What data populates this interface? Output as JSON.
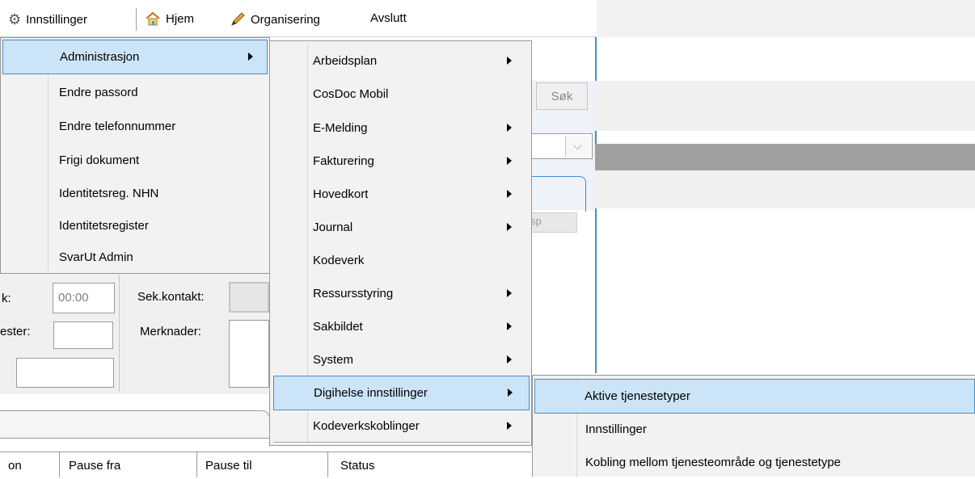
{
  "menubar": {
    "settings_label": "Innstillinger",
    "home_label": "Hjem",
    "organize_label": "Organisering",
    "exit_label": "Avslutt"
  },
  "background": {
    "search_label": "Søk",
    "time_value": "00:00",
    "partial_k_label": "k:",
    "sek_kontakt_label": "Sek.kontakt:",
    "partial_ester_label": "ester:",
    "merknader_label": "Merknader:",
    "partial_sp_label": "sp",
    "table_headers": [
      "on",
      "Pause fra",
      "Pause til",
      "Status"
    ]
  },
  "menu1": {
    "items": [
      {
        "label": "Administrasjon",
        "has_submenu": true
      },
      {
        "label": "Endre passord"
      },
      {
        "label": "Endre telefonnummer"
      },
      {
        "label": "Frigi dokument"
      },
      {
        "label": "Identitetsreg. NHN"
      },
      {
        "label": "Identitetsregister"
      },
      {
        "label": "SvarUt Admin"
      }
    ]
  },
  "menu2": {
    "items": [
      {
        "label": "Arbeidsplan",
        "has_submenu": true
      },
      {
        "label": "CosDoc Mobil"
      },
      {
        "label": "E-Melding",
        "has_submenu": true
      },
      {
        "label": "Fakturering",
        "has_submenu": true
      },
      {
        "label": "Hovedkort",
        "has_submenu": true
      },
      {
        "label": "Journal",
        "has_submenu": true
      },
      {
        "label": "Kodeverk"
      },
      {
        "label": "Ressursstyring",
        "has_submenu": true
      },
      {
        "label": "Sakbildet",
        "has_submenu": true
      },
      {
        "label": "System",
        "has_submenu": true
      },
      {
        "label": "Digihelse innstillinger",
        "has_submenu": true
      },
      {
        "label": "Kodeverkskoblinger",
        "has_submenu": true
      }
    ]
  },
  "menu3": {
    "items": [
      {
        "label": "Aktive tjenestetyper"
      },
      {
        "label": "Innstillinger"
      },
      {
        "label": "Kobling mellom tjenesteområde og tjenestetype"
      }
    ]
  },
  "colors": {
    "highlight_bg": "#cce4f7",
    "highlight_border": "#3f8fd7",
    "menu_bg": "#f2f2f2"
  }
}
